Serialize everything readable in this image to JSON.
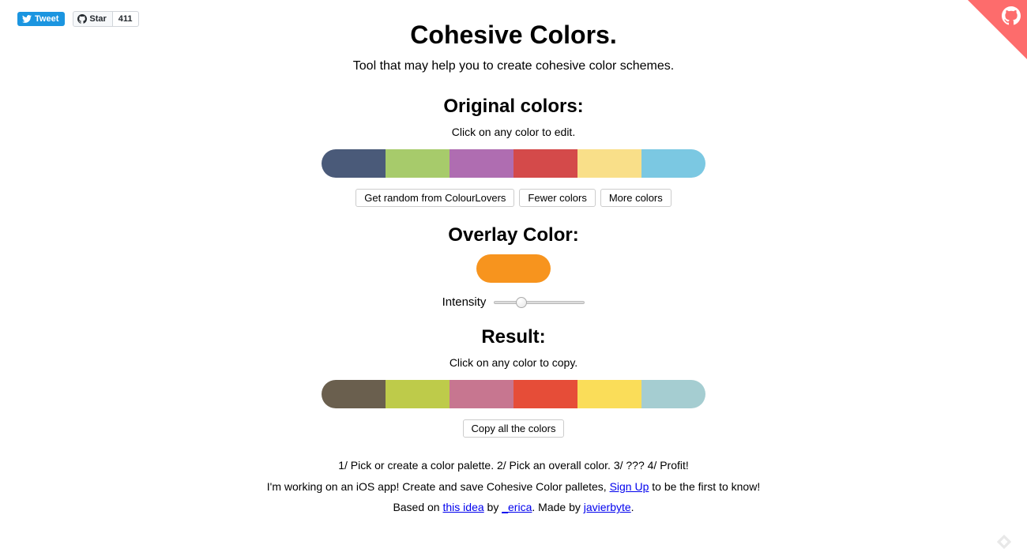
{
  "badges": {
    "tweet_label": "Tweet",
    "star_label": "Star",
    "star_count": "411"
  },
  "header": {
    "title": "Cohesive Colors.",
    "subtitle": "Tool that may help you to create cohesive color schemes."
  },
  "original": {
    "heading": "Original colors:",
    "hint": "Click on any color to edit.",
    "colors": [
      "#4a5a79",
      "#a7cb6b",
      "#af6db1",
      "#d44a4a",
      "#f9df89",
      "#7bc8e2"
    ],
    "btn_random": "Get random from ColourLovers",
    "btn_fewer": "Fewer colors",
    "btn_more": "More colors"
  },
  "overlay": {
    "heading": "Overlay Color:",
    "color": "#f7941e",
    "intensity_label": "Intensity",
    "intensity_value": 0.3
  },
  "result": {
    "heading": "Result:",
    "hint": "Click on any color to copy.",
    "colors": [
      "#6a5f4e",
      "#becb4a",
      "#c77690",
      "#e64d38",
      "#fadd59",
      "#a5cdd1"
    ],
    "btn_copy_all": "Copy all the colors"
  },
  "footer": {
    "steps": "1/ Pick or create a color palette. 2/ Pick an overall color. 3/ ??? 4/ Profit!",
    "ios_pre": "I'm working on an iOS app! Create and save Cohesive Color palletes, ",
    "ios_link": "Sign Up",
    "ios_post": " to be the first to know!",
    "based_pre": "Based on ",
    "based_link": "this idea",
    "based_by": " by ",
    "erica_link": "_erica",
    "made_mid": ". Made by ",
    "author_link": "javierbyte",
    "made_end": "."
  }
}
